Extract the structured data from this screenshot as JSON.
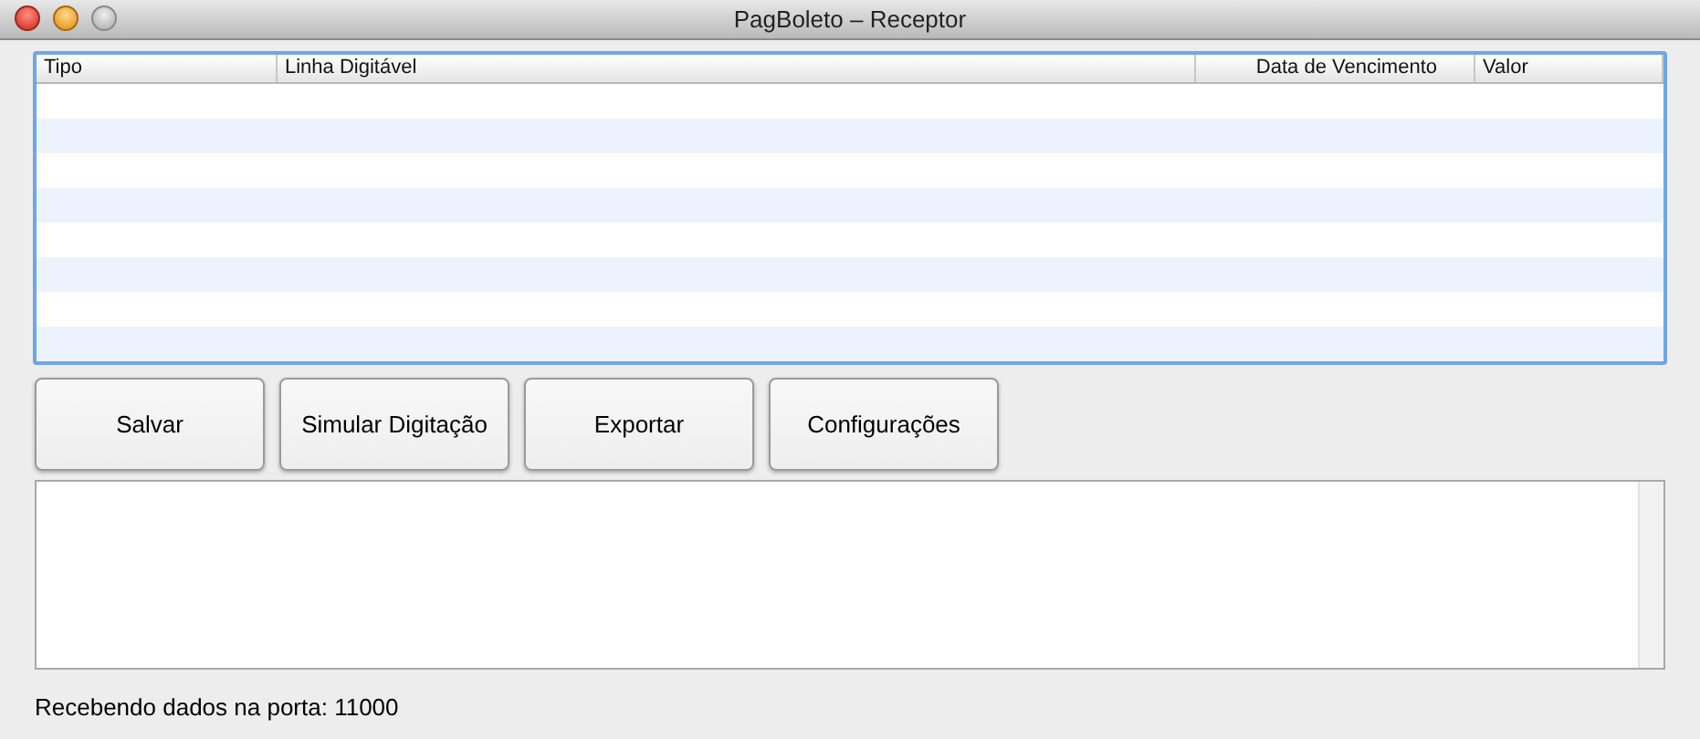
{
  "window": {
    "title": "PagBoleto – Receptor"
  },
  "table": {
    "columns": [
      "Tipo",
      "Linha Digitável",
      "Data de Vencimento",
      "Valor"
    ]
  },
  "buttons": [
    "Salvar",
    "Simular Digitação",
    "Exportar",
    "Configurações"
  ],
  "status_bar": "Recebendo dados na porta: 11000"
}
